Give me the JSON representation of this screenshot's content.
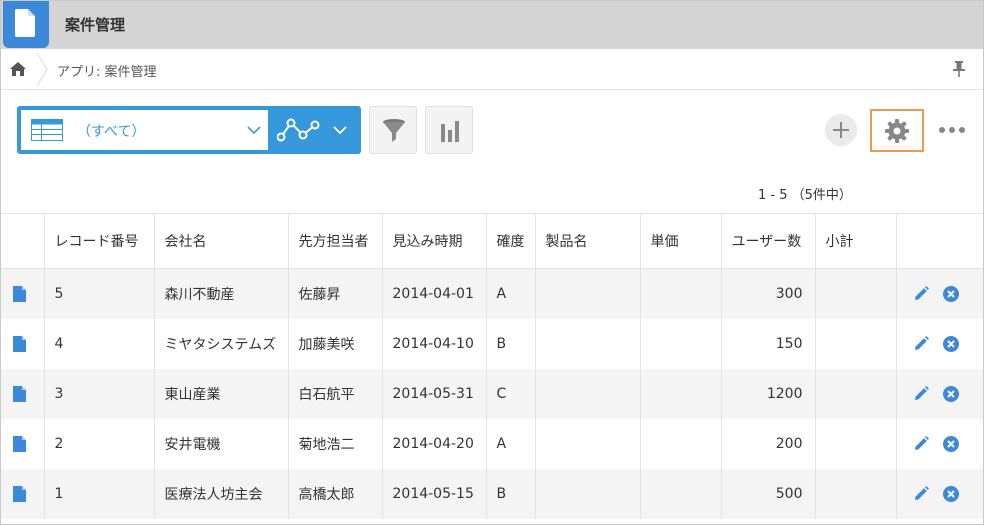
{
  "app": {
    "title": "案件管理",
    "breadcrumb": "アプリ: 案件管理"
  },
  "toolbar": {
    "view_label": "（すべて）"
  },
  "pager": "1 - 5 （5件中）",
  "colors": {
    "accent": "#3498db",
    "highlight": "#f0994a",
    "header_bar": "#d4d4d4",
    "row_alt": "#f4f4f4"
  },
  "table": {
    "headers": [
      "レコード番号",
      "会社名",
      "先方担当者",
      "見込み時期",
      "確度",
      "製品名",
      "単価",
      "ユーザー数",
      "小計"
    ],
    "rows": [
      {
        "id": "5",
        "company": "森川不動産",
        "contact": "佐藤昇",
        "date": "2014-04-01",
        "rank": "A",
        "product": "",
        "price": "",
        "users": "300",
        "subtotal": ""
      },
      {
        "id": "4",
        "company": "ミヤタシステムズ",
        "contact": "加藤美咲",
        "date": "2014-04-10",
        "rank": "B",
        "product": "",
        "price": "",
        "users": "150",
        "subtotal": ""
      },
      {
        "id": "3",
        "company": "東山産業",
        "contact": "白石航平",
        "date": "2014-05-31",
        "rank": "C",
        "product": "",
        "price": "",
        "users": "1200",
        "subtotal": ""
      },
      {
        "id": "2",
        "company": "安井電機",
        "contact": "菊地浩二",
        "date": "2014-04-20",
        "rank": "A",
        "product": "",
        "price": "",
        "users": "200",
        "subtotal": ""
      },
      {
        "id": "1",
        "company": "医療法人坊主会",
        "contact": "高橋太郎",
        "date": "2014-05-15",
        "rank": "B",
        "product": "",
        "price": "",
        "users": "500",
        "subtotal": ""
      }
    ]
  },
  "icons": {
    "app": "document-app-icon",
    "home": "home-icon",
    "pin": "pin-icon",
    "view": "table-grid-icon",
    "graph": "line-graph-icon",
    "filter": "funnel-icon",
    "chart": "bar-chart-icon",
    "add": "plus-icon",
    "settings": "gear-icon",
    "more": "ellipsis-icon",
    "row_detail": "document-icon",
    "row_edit": "pencil-icon",
    "row_delete": "close-circle-icon"
  }
}
